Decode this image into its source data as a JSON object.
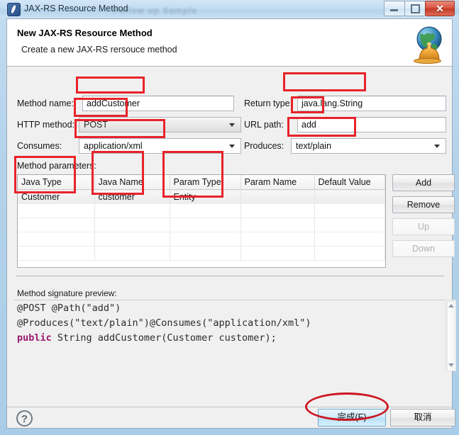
{
  "window": {
    "title": "JAX-RS Resource Method",
    "ghost_title": "Follow up Sample",
    "app_icon": "jaxrs-icon",
    "controls": {
      "minimize": "minimize-icon",
      "maximize": "restore-icon",
      "close": "✕"
    }
  },
  "banner": {
    "title": "New JAX-RS Resource Method",
    "subtitle": "Create a new JAX-RS rersouce method",
    "icon": "globe-bell-icon"
  },
  "form": {
    "method_name": {
      "label": "Method name:",
      "value": "addCustomer",
      "placeholder": ""
    },
    "return_type": {
      "label": "Return type:",
      "value": "java.lang.String",
      "placeholder": ""
    },
    "http_method": {
      "label": "HTTP method:",
      "value": "POST"
    },
    "url_path": {
      "label": "URL path:",
      "value": "add",
      "placeholder": ""
    },
    "consumes": {
      "label": "Consumes:",
      "value": "application/xml"
    },
    "produces": {
      "label": "Produces:",
      "value": "text/plain"
    }
  },
  "parameters": {
    "label": "Method parameters:",
    "columns": [
      "Java Type",
      "Java Name",
      "Param Type",
      "Param Name",
      "Default Value"
    ],
    "rows": [
      [
        "Customer",
        "customer",
        "Entity",
        "",
        ""
      ]
    ],
    "empty_rows": 4,
    "buttons": [
      {
        "label": "Add",
        "enabled": true
      },
      {
        "label": "Remove",
        "enabled": true
      },
      {
        "label": "Up",
        "enabled": false
      },
      {
        "label": "Down",
        "enabled": false
      }
    ]
  },
  "preview": {
    "label": "Method signature preview:",
    "line1": "@POST @Path(\"add\")",
    "line2": "@Produces(\"text/plain\")@Consumes(\"application/xml\")",
    "line3_keyword": "public",
    "line3_rest": " String addCustomer(Customer customer);",
    "keyword_color": "#9c1a6e",
    "scrollbar": {
      "up": "scroll-up-arrow",
      "down": "scroll-down-arrow"
    }
  },
  "footer": {
    "help": "?",
    "finish": "完成(F)",
    "cancel": "取消"
  },
  "annotations": {
    "color": "#e8232a",
    "ellipse_color": "#cc1721"
  }
}
